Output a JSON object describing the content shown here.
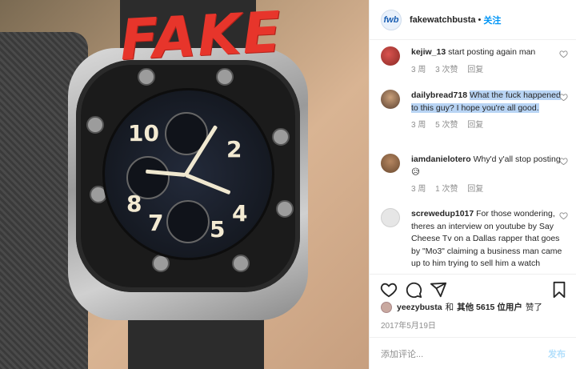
{
  "photo": {
    "stamp_text": "FAKE"
  },
  "header": {
    "avatar_text": "fwb",
    "username": "fakewatchbusta",
    "separator": "•",
    "follow_label": "关注"
  },
  "comments": [
    {
      "username": "kejiw_13",
      "text": "start posting again man",
      "highlight": false,
      "time": "3 周",
      "likes": "3 次赞",
      "reply": "回复"
    },
    {
      "username": "dailybread718",
      "text": "What the fuck happened to this guy? I hope you're all good.",
      "highlight": true,
      "time": "3 周",
      "likes": "5 次赞",
      "reply": "回复"
    },
    {
      "username": "iamdanielotero",
      "text": "Why'd y'all stop posting 😥",
      "highlight": false,
      "time": "3 周",
      "likes": "1 次赞",
      "reply": "回复"
    },
    {
      "username": "screwedup1017",
      "text": "For those wondering, theres an interview on youtube by Say Cheese Tv on a Dallas rapper that goes by \"Mo3\" claiming a business man came up to him trying to sell him a watch",
      "highlight": false,
      "time": "",
      "likes": "",
      "reply": ""
    }
  ],
  "likes": {
    "user": "yeezybusta",
    "and": "和",
    "others": "其他 5615 位用户",
    "suffix": "赞了"
  },
  "date": "2017年5月19日",
  "composer": {
    "placeholder": "添加评论...",
    "post_label": "发布"
  },
  "icons": [
    "heart-icon",
    "comment-icon",
    "share-icon",
    "bookmark-icon"
  ],
  "colors": {
    "accent": "#0095f6",
    "highlight": "#b8d4f4",
    "stamp": "#e7352b"
  }
}
